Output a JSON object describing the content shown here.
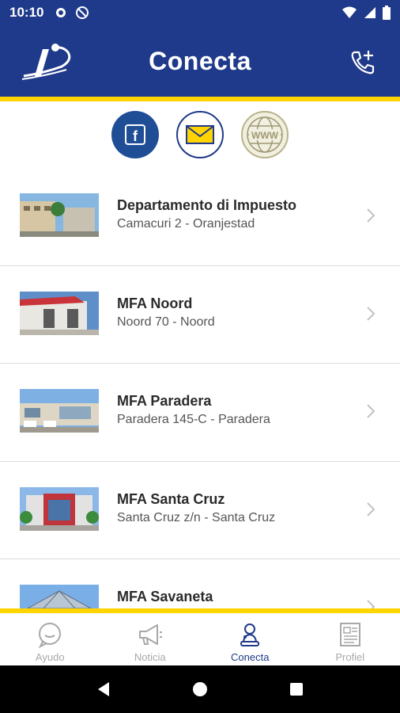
{
  "status_bar": {
    "time": "10:10"
  },
  "header": {
    "title": "Conecta"
  },
  "social": {
    "facebook": "f",
    "email": "email-icon",
    "website": "WWW"
  },
  "items": [
    {
      "title": "Departamento di Impuesto",
      "subtitle": "Camacuri 2 - Oranjestad"
    },
    {
      "title": "MFA Noord",
      "subtitle": "Noord 70 - Noord"
    },
    {
      "title": "MFA Paradera",
      "subtitle": "Paradera 145-C - Paradera"
    },
    {
      "title": "MFA Santa Cruz",
      "subtitle": "Santa Cruz z/n - Santa Cruz"
    },
    {
      "title": "MFA Savaneta",
      "subtitle": ""
    }
  ],
  "bottom_nav": [
    {
      "label": "Ayudo",
      "icon": "chat-bubble-icon",
      "active": false
    },
    {
      "label": "Noticia",
      "icon": "megaphone-icon",
      "active": false
    },
    {
      "label": "Conecta",
      "icon": "contact-icon",
      "active": true
    },
    {
      "label": "Profiel",
      "icon": "profile-card-icon",
      "active": false
    }
  ],
  "colors": {
    "primary": "#1f3a8a",
    "accent": "#ffd400",
    "inactive": "#a8a8a8"
  }
}
